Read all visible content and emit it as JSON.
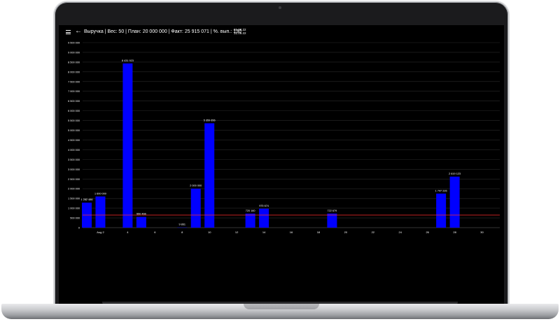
{
  "header": {
    "title": "Выручка | Вес: 50 | План: 20 000 000 | Факт: 25 915 071 | %. вып.: 130",
    "date_from": "01.08.22",
    "date_to": "31.08.22"
  },
  "icons": {
    "menu": "menu-icon",
    "back": "arrow-left-icon"
  },
  "colors": {
    "bar": "#0000ff",
    "plan_line": "#ff2a2a",
    "background": "#000000",
    "text": "#ffffff"
  },
  "chart_data": {
    "type": "bar",
    "x_domain": [
      1,
      31
    ],
    "ylim": [
      0,
      9500000
    ],
    "y_tick_step": 500000,
    "y_tick_labels": [
      "0",
      "500 000",
      "1 000 000",
      "1 500 000",
      "2 000 000",
      "2 500 000",
      "3 000 000",
      "3 500 000",
      "4 000 000",
      "4 500 000",
      "5 000 000",
      "5 500 000",
      "6 000 000",
      "6 500 000",
      "7 000 000",
      "7 500 000",
      "8 000 000",
      "8 500 000",
      "9 000 000",
      "9 500 000"
    ],
    "x_ticks": [
      {
        "day": 2,
        "label": "Aug 2"
      },
      {
        "day": 4,
        "label": "4"
      },
      {
        "day": 6,
        "label": "6"
      },
      {
        "day": 8,
        "label": "8"
      },
      {
        "day": 10,
        "label": "10"
      },
      {
        "day": 12,
        "label": "12"
      },
      {
        "day": 14,
        "label": "14"
      },
      {
        "day": 16,
        "label": "16"
      },
      {
        "day": 18,
        "label": "18"
      },
      {
        "day": 20,
        "label": "20"
      },
      {
        "day": 22,
        "label": "22"
      },
      {
        "day": 24,
        "label": "24"
      },
      {
        "day": 26,
        "label": "26"
      },
      {
        "day": 28,
        "label": "28"
      },
      {
        "day": 30,
        "label": "30"
      }
    ],
    "bars": [
      {
        "day": 1,
        "value": 1282486,
        "label": "1 282 486"
      },
      {
        "day": 2,
        "value": 1600000,
        "label": "1 600 000"
      },
      {
        "day": 4,
        "value": 8431923,
        "label": "8 431 923"
      },
      {
        "day": 5,
        "value": 550466,
        "label": "550 466"
      },
      {
        "day": 8,
        "value": 9861,
        "label": "9 861"
      },
      {
        "day": 9,
        "value": 2000000,
        "label": "2 000 000"
      },
      {
        "day": 10,
        "value": 5359656,
        "label": "5 359 656"
      },
      {
        "day": 13,
        "value": 720160,
        "label": "720 160"
      },
      {
        "day": 14,
        "value": 975674,
        "label": "975 674"
      },
      {
        "day": 19,
        "value": 722679,
        "label": "722 679"
      },
      {
        "day": 27,
        "value": 1747226,
        "label": "1 747 226"
      },
      {
        "day": 28,
        "value": 2619123,
        "label": "2 619 123"
      }
    ],
    "plan_line_value": 645161,
    "grid": true
  }
}
